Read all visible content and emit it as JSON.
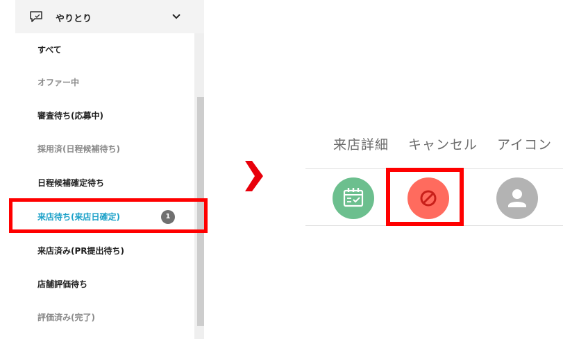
{
  "sidebar": {
    "section_title": "やりとり",
    "items": [
      {
        "label": "すべて",
        "state": "normal"
      },
      {
        "label": "オファー中",
        "state": "muted"
      },
      {
        "label": "審査待ち(応募中)",
        "state": "normal"
      },
      {
        "label": "採用済(日程候補待ち)",
        "state": "muted"
      },
      {
        "label": "日程候補確定待ち",
        "state": "normal"
      },
      {
        "label": "来店待ち(来店日確定)",
        "state": "active",
        "badge": "1"
      },
      {
        "label": "来店済み(PR提出待ち)",
        "state": "normal"
      },
      {
        "label": "店舗評価待ち",
        "state": "normal"
      },
      {
        "label": "評価済み(完了)",
        "state": "muted"
      }
    ]
  },
  "table": {
    "columns": [
      "来店詳細",
      "キャンセル",
      "アイコン"
    ],
    "icons": {
      "detail": {
        "name": "calendar-check-icon",
        "color": "#6cbf8e"
      },
      "cancel": {
        "name": "prohibited-icon",
        "color": "#ff6b5e"
      },
      "avatar": {
        "name": "user-avatar-icon",
        "color": "#b3b3b3"
      }
    }
  },
  "colors": {
    "highlight": "#ff0000",
    "active_text": "#1aa0c8",
    "arrow": "#e8000b"
  }
}
